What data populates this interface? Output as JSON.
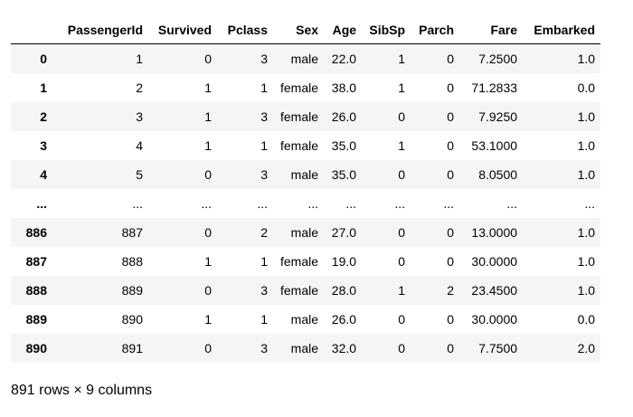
{
  "table": {
    "index_header": "",
    "columns": [
      "PassengerId",
      "Survived",
      "Pclass",
      "Sex",
      "Age",
      "SibSp",
      "Parch",
      "Fare",
      "Embarked"
    ],
    "rows": [
      {
        "index": "0",
        "cells": [
          "1",
          "0",
          "3",
          "male",
          "22.0",
          "1",
          "0",
          "7.2500",
          "1.0"
        ]
      },
      {
        "index": "1",
        "cells": [
          "2",
          "1",
          "1",
          "female",
          "38.0",
          "1",
          "0",
          "71.2833",
          "0.0"
        ]
      },
      {
        "index": "2",
        "cells": [
          "3",
          "1",
          "3",
          "female",
          "26.0",
          "0",
          "0",
          "7.9250",
          "1.0"
        ]
      },
      {
        "index": "3",
        "cells": [
          "4",
          "1",
          "1",
          "female",
          "35.0",
          "1",
          "0",
          "53.1000",
          "1.0"
        ]
      },
      {
        "index": "4",
        "cells": [
          "5",
          "0",
          "3",
          "male",
          "35.0",
          "0",
          "0",
          "8.0500",
          "1.0"
        ]
      },
      {
        "index": "...",
        "cells": [
          "...",
          "...",
          "...",
          "...",
          "...",
          "...",
          "...",
          "...",
          "..."
        ]
      },
      {
        "index": "886",
        "cells": [
          "887",
          "0",
          "2",
          "male",
          "27.0",
          "0",
          "0",
          "13.0000",
          "1.0"
        ]
      },
      {
        "index": "887",
        "cells": [
          "888",
          "1",
          "1",
          "female",
          "19.0",
          "0",
          "0",
          "30.0000",
          "1.0"
        ]
      },
      {
        "index": "888",
        "cells": [
          "889",
          "0",
          "3",
          "female",
          "28.0",
          "1",
          "2",
          "23.4500",
          "1.0"
        ]
      },
      {
        "index": "889",
        "cells": [
          "890",
          "1",
          "1",
          "male",
          "26.0",
          "0",
          "0",
          "30.0000",
          "0.0"
        ]
      },
      {
        "index": "890",
        "cells": [
          "891",
          "0",
          "3",
          "male",
          "32.0",
          "0",
          "0",
          "7.7500",
          "2.0"
        ]
      }
    ]
  },
  "footer": {
    "text": "891 rows × 9 columns"
  }
}
